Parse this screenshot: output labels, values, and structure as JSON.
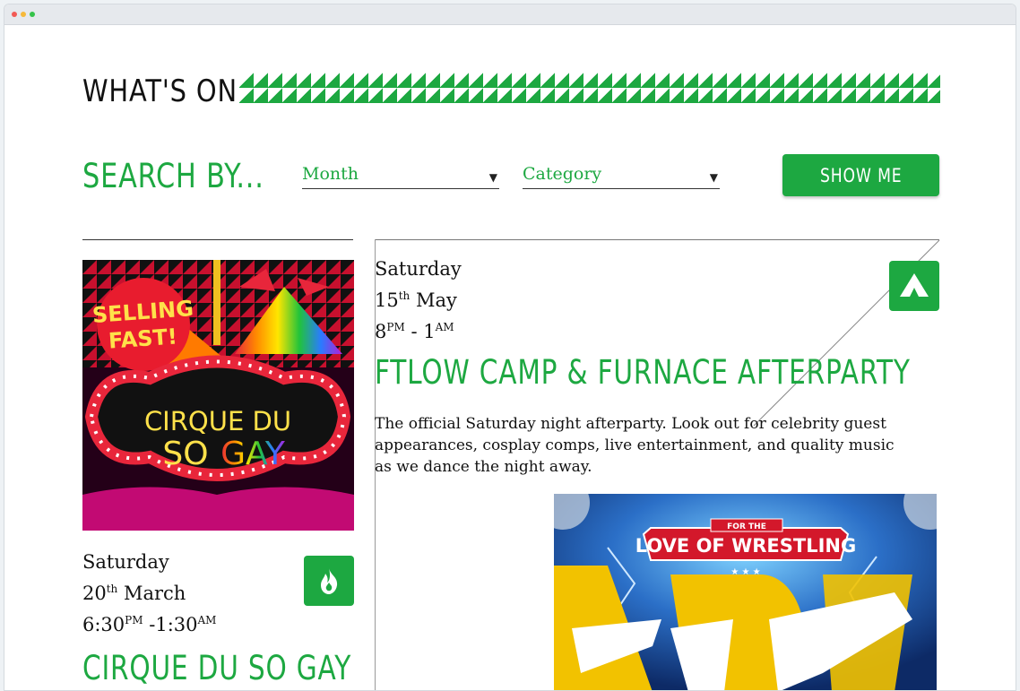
{
  "page": {
    "heading": "WHAT'S ON",
    "search": {
      "label": "SEARCH BY...",
      "month_value": "Month",
      "category_value": "Category",
      "button_label": "SHOW ME"
    }
  },
  "events": [
    {
      "day": "Saturday",
      "date_num": "20",
      "date_suffix": "th",
      "month": "March",
      "time_start": "6:30",
      "time_start_suffix": "PM",
      "time_end": "-1:30",
      "time_end_suffix": "AM",
      "title": "CIRQUE DU SO GAY",
      "badge": "SELLING FAST!",
      "poster_line1": "CIRQUE DU",
      "poster_line2a": "SO",
      "poster_line2b": "GAY",
      "icon": "fire-icon"
    },
    {
      "day": "Saturday",
      "date_num": "15",
      "date_suffix": "th",
      "month": "May",
      "time_start": "8",
      "time_start_suffix": "PM",
      "time_end": "- 1",
      "time_end_suffix": "AM",
      "title": "FTLOW CAMP & FURNACE AFTERPARTY",
      "description": "The official Saturday night afterparty. Look out for celebrity guest appearances, cosplay comps, live entertainment, and quality music as we dance the night away.",
      "icon": "camp-tent-icon",
      "poster_top": "FOR THE",
      "poster_banner": "LOVE OF WRESTLING"
    }
  ],
  "colors": {
    "accent": "#1da841",
    "text": "#111111",
    "background": "#ffffff"
  }
}
